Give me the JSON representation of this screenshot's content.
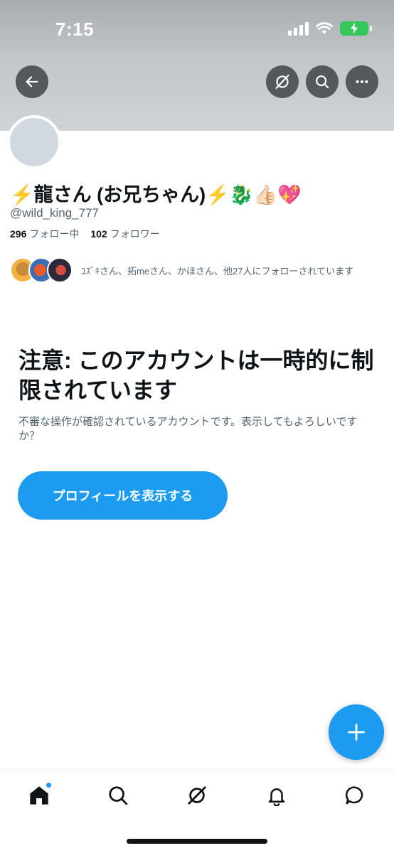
{
  "status_bar": {
    "time": "7:15"
  },
  "header": {
    "back_icon": "arrow-left-icon",
    "grok_icon": "grok-icon",
    "search_icon": "search-icon",
    "more_icon": "more-horizontal-icon"
  },
  "profile": {
    "display_name": "⚡️龍さん (お兄ちゃん)⚡️🐉👍🏻💖",
    "handle": "@wild_king_777",
    "following_count": "296",
    "following_label": "フォロー中",
    "followers_count": "102",
    "followers_label": "フォロワー",
    "followed_by_text": "ﾕｽﾞｷさん、拓meさん、かほさん、他27人にフォローされています"
  },
  "warning": {
    "title": "注意: このアカウントは一時的に制限されています",
    "description": "不審な操作が確認されているアカウントです。表示してもよろしいですか？",
    "button_label": "プロフィールを表示する"
  },
  "fab": {
    "icon": "plus-icon"
  },
  "tabbar": {
    "items": [
      "home-icon",
      "search-icon",
      "grok-icon",
      "notifications-icon",
      "messages-icon"
    ]
  },
  "colors": {
    "accent": "#1d9bf0",
    "text": "#0f1419",
    "secondary_text": "#536471",
    "avatar_placeholder": "#cfd9de"
  }
}
